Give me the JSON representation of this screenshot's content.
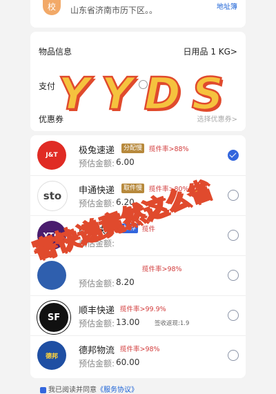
{
  "top": {
    "badge": "校",
    "address": "山东省济南市历下区。。",
    "link": "地址簿"
  },
  "info": {
    "goods_label": "物品信息",
    "goods_value": "日用品 1 KG>",
    "pay_label": "支付",
    "coupon_label": "优惠券",
    "coupon_value": "选择优惠券>"
  },
  "couriers": [
    {
      "name": "极兔速递",
      "tag": "分配慢",
      "tag_color": "#b7893c",
      "rate": "揽件率>88%",
      "price_label": "预估金额:",
      "price": "6.00",
      "extra": "",
      "selected": true,
      "logo": "J&T"
    },
    {
      "name": "申通快递",
      "tag": "取件慢",
      "tag_color": "#b7893c",
      "rate": "揽件率>80%",
      "price_label": "预估金额:",
      "price": "6.20",
      "extra": "",
      "selected": false,
      "logo": "sto"
    },
    {
      "name": "圆通快递",
      "tag": "推荐",
      "tag_color": "#3366dd",
      "rate": "揽件",
      "price_label": "预估金额:",
      "price": "",
      "extra": "",
      "selected": false,
      "logo": "YTO"
    },
    {
      "name": "",
      "tag": "",
      "tag_color": "",
      "rate": "揽件率>98%",
      "price_label": "预估金额:",
      "price": "8.20",
      "extra": "",
      "selected": false,
      "logo": ""
    },
    {
      "name": "顺丰快递",
      "tag": "",
      "tag_color": "",
      "rate": "揽件率>99.9%",
      "price_label": "预估金额:",
      "price": "13.00",
      "extra": "签收返现:1.9",
      "selected": false,
      "logo": "SF"
    },
    {
      "name": "德邦物流",
      "tag": "",
      "tag_color": "",
      "rate": "揽件率>98%",
      "price_label": "预估金额:",
      "price": "60.00",
      "extra": "",
      "selected": false,
      "logo": "德邦"
    }
  ],
  "bottom": {
    "prefix": "我已阅读并同意",
    "link": "《服务协议》"
  },
  "overlay": {
    "title": "YYDS",
    "slogan": "寄快递竟然这么省"
  },
  "colors": {
    "accent": "#3366dd",
    "overlay_fill": "#f5c23e",
    "overlay_stroke": "#e04a2d"
  }
}
